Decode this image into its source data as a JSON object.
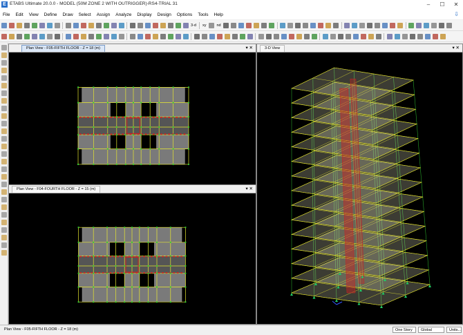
{
  "window": {
    "title": "ETABS Ultimate 20.0.0 - MODEL (50M ZONE 2 WITH OUTRIGGER)-RS4-TRIAL 31",
    "app_icon_letter": "E",
    "minimize": "–",
    "maximize": "☐",
    "close": "✕"
  },
  "menu": {
    "items": [
      "File",
      "Edit",
      "View",
      "Define",
      "Draw",
      "Select",
      "Assign",
      "Analyze",
      "Display",
      "Design",
      "Options",
      "Tools",
      "Help"
    ],
    "help_icon": "arrow-down-icon"
  },
  "toolbar": {
    "label_3d": "3-d",
    "label_xy": "xy",
    "label_nd": "nd"
  },
  "panels": {
    "plan_top": {
      "title": "Plan View - F05-FIFTH FLOOR - Z = 18 (m)",
      "pin": "▾",
      "close": "✕"
    },
    "plan_bottom": {
      "title": "Plan View - F04-FOURTH FLOOR - Z = 15 (m)",
      "pin": "▾",
      "close": "✕"
    },
    "view_3d": {
      "title": "3-D View",
      "pin": "▾",
      "close": "✕"
    }
  },
  "status": {
    "text": "Plan View - F05-FIFTH FLOOR - Z = 18 (m)",
    "story": "One Story",
    "coord": "Global",
    "units": "Units..."
  },
  "colors": {
    "grid": "#e6e62e",
    "slab": "#7a7a7a",
    "beam": "#33cc33",
    "core": "#cc2222",
    "support": "#22cc66"
  }
}
